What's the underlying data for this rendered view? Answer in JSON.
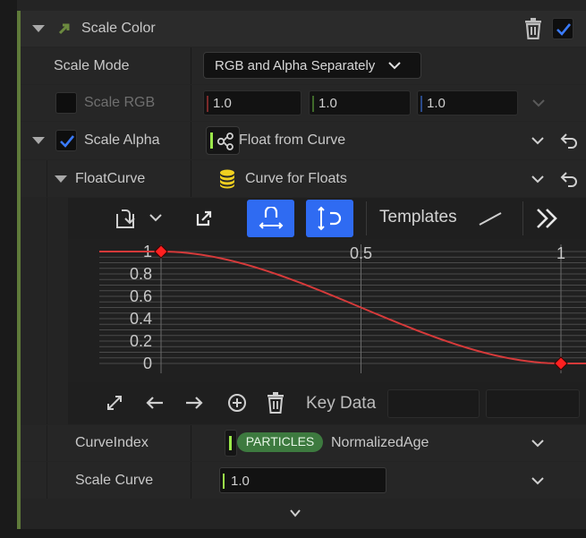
{
  "header": {
    "title": "Scale Color",
    "enabled": true
  },
  "scale_mode": {
    "label": "Scale Mode",
    "value": "RGB and Alpha Separately"
  },
  "scale_rgb": {
    "label": "Scale RGB",
    "enabled": false,
    "r": "1.0",
    "g": "1.0",
    "b": "1.0"
  },
  "scale_alpha": {
    "label": "Scale Alpha",
    "enabled": true,
    "value": "Float from Curve"
  },
  "float_curve": {
    "label": "FloatCurve",
    "value": "Curve for Floats"
  },
  "toolbar": {
    "templates_label": "Templates"
  },
  "curve_editor": {
    "x_ticks": [
      "0.5",
      "1"
    ],
    "y_ticks": [
      "1",
      "0.8",
      "0.6",
      "0.4",
      "0.2",
      "0"
    ],
    "keys": [
      {
        "x": 0.0,
        "y": 1.0
      },
      {
        "x": 1.0,
        "y": 0.0
      }
    ],
    "curve_color": "#d63a3a",
    "key_color": "#ff2020"
  },
  "key_bar": {
    "key_data_label": "Key Data"
  },
  "curve_index": {
    "label": "CurveIndex",
    "badge": "PARTICLES",
    "value": "NormalizedAge"
  },
  "scale_curve": {
    "label": "Scale Curve",
    "value": "1.0"
  },
  "colors": {
    "accent": "#2f6bf2",
    "green_accent": "#5f7a3a",
    "badge_green": "#3d7a3f"
  }
}
